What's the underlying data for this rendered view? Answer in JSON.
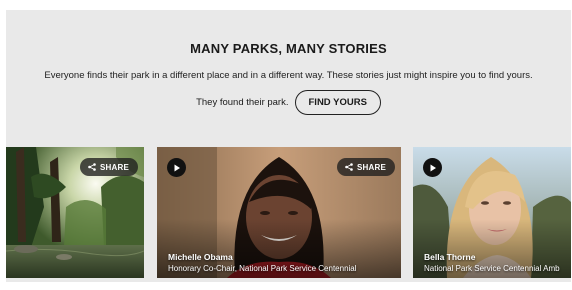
{
  "section": {
    "title": "MANY PARKS, MANY STORIES",
    "intro": "Everyone finds their park in a different place and in a different way. These stories just might inspire you to find yours.",
    "cta_prompt": "They found their park.",
    "cta_button": "FIND YOURS"
  },
  "cards": [
    {
      "share_label": "SHARE",
      "icon": "share-icon"
    },
    {
      "share_label": "SHARE",
      "icon": "play-icon",
      "name": "Michelle Obama",
      "role": "Honorary Co-Chair, National Park Service Centennial"
    },
    {
      "icon": "play-icon",
      "name": "Bella Thorne",
      "role": "National Park Service Centennial Amb"
    }
  ],
  "colors": {
    "panel": "#e9e9e9",
    "button_border": "#222222",
    "overlay": "#1e1e1e"
  }
}
